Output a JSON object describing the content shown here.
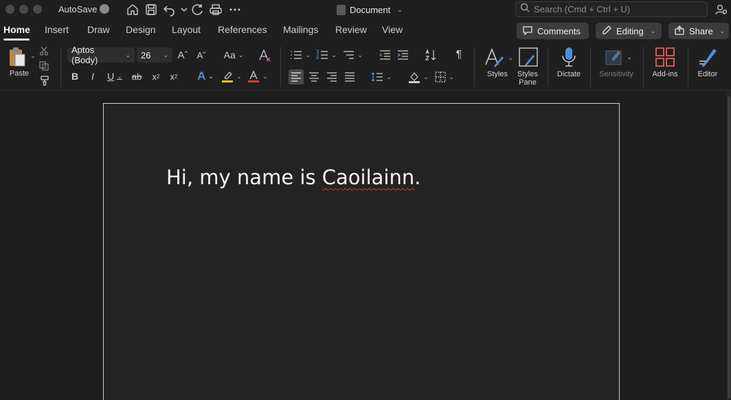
{
  "titlebar": {
    "autosave_label": "AutoSave",
    "document_title": "Document",
    "search_placeholder": "Search (Cmd + Ctrl + U)"
  },
  "tabs": [
    {
      "label": "Home",
      "active": true
    },
    {
      "label": "Insert"
    },
    {
      "label": "Draw"
    },
    {
      "label": "Design"
    },
    {
      "label": "Layout"
    },
    {
      "label": "References"
    },
    {
      "label": "Mailings"
    },
    {
      "label": "Review"
    },
    {
      "label": "View"
    }
  ],
  "actions": {
    "comments": "Comments",
    "editing": "Editing",
    "share": "Share"
  },
  "ribbon": {
    "paste_label": "Paste",
    "font_name": "Aptos (Body)",
    "font_size": "26",
    "styles_label": "Styles",
    "styles_pane_label": "Styles Pane",
    "dictate_label": "Dictate",
    "sensitivity_label": "Sensitivity",
    "addins_label": "Add-ins",
    "editor_label": "Editor"
  },
  "document": {
    "text_before": "Hi, my name is ",
    "misspelled_word": "Caoilainn",
    "text_after": "."
  },
  "colors": {
    "accent_blue": "#4a90d9",
    "highlight_yellow": "#f2c01d",
    "font_red": "#e03a3a",
    "addins_red": "#d9534f",
    "spell_squiggle": "#d23a3a"
  }
}
